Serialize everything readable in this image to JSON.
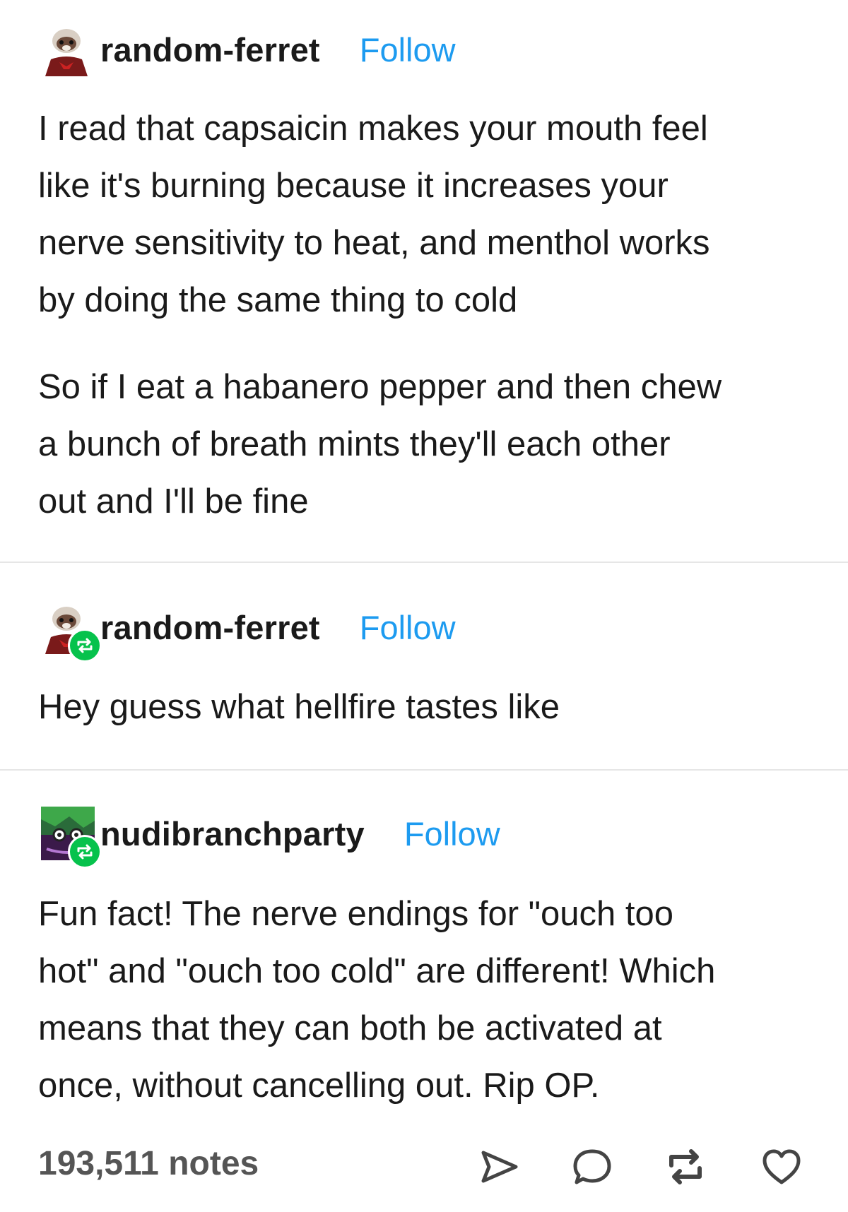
{
  "posts": [
    {
      "username": "random-ferret",
      "follow_label": "Follow",
      "paragraphs": [
        "I read that capsaicin makes your mouth feel",
        "like it's burning because it increases your",
        "nerve sensitivity to heat, and menthol works",
        "by doing the same thing to cold"
      ],
      "paragraphs2": [
        "So if I eat a habanero pepper and then chew",
        "a bunch of breath mints they'll each other",
        "out and I'll be fine"
      ]
    },
    {
      "username": "random-ferret",
      "follow_label": "Follow",
      "text": "Hey guess what hellfire tastes like"
    },
    {
      "username": "nudibranchparty",
      "follow_label": "Follow",
      "lines": [
        "Fun fact!  The nerve endings for \"ouch too",
        "hot\" and \"ouch too cold\" are different!  Which",
        "means that they can both be activated at",
        "once, without cancelling out.  Rip OP."
      ]
    }
  ],
  "footer": {
    "notes": "193,511 notes",
    "icons": [
      "send-icon",
      "comment-icon",
      "reblog-icon",
      "heart-icon"
    ]
  },
  "colors": {
    "follow": "#1d9bf0",
    "reblog_badge": "#06c24c"
  }
}
